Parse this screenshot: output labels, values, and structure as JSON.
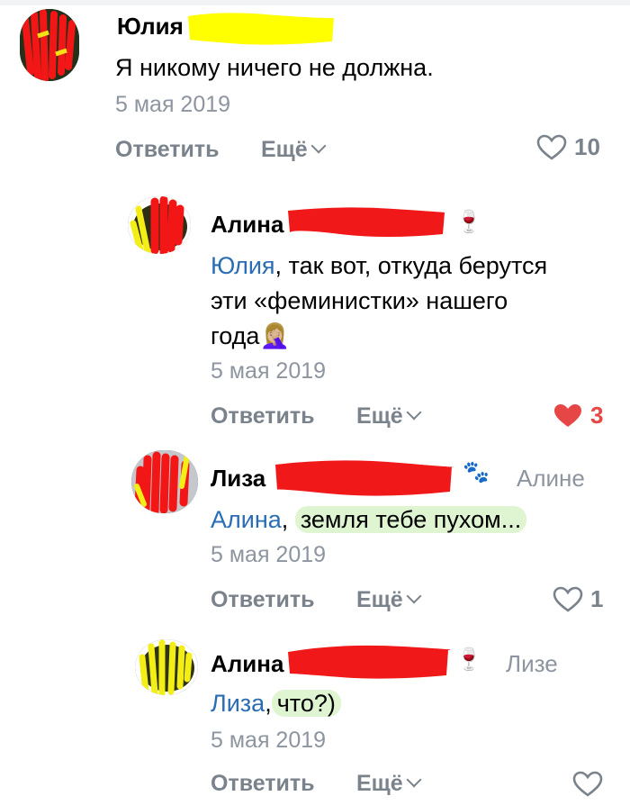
{
  "comments": [
    {
      "author": "Юлия",
      "text": "Я никому ничего не должна.",
      "date": "5 мая 2019",
      "reply": "Ответить",
      "more": "Ещё",
      "likes": "10",
      "liked": false
    },
    {
      "author": "Алина",
      "mention": "Юлия",
      "text_line1": ", так вот, откуда берутся",
      "text_line2": "эти «феминистки» нашего",
      "text_line3": "года",
      "emoji_face": "🤦🏼‍♀️",
      "emoji_badge": "🍷",
      "date": "5 мая 2019",
      "reply": "Ответить",
      "more": "Ещё",
      "likes": "3",
      "liked": true
    },
    {
      "author": "Лиза",
      "emoji_badge": "🐾",
      "reply_to": "Алине",
      "mention": "Алина",
      "sep": ",",
      "text": "земля тебе пухом...",
      "date": "5 мая 2019",
      "reply": "Ответить",
      "more": "Ещё",
      "likes": "1",
      "liked": false
    },
    {
      "author": "Алина",
      "emoji_badge": "🍷",
      "reply_to": "Лизе",
      "mention": "Лиза",
      "sep": ",",
      "text": "что?)",
      "date": "5 мая 2019",
      "reply": "Ответить",
      "more": "Ещё",
      "liked": false
    }
  ],
  "colors": {
    "link": "#2a6db5",
    "meta": "#8d95a0",
    "like_active": "#e64646",
    "highlight": "#dff5d2",
    "redaction_red": "#f01818",
    "redaction_yellow": "#ffff00"
  }
}
